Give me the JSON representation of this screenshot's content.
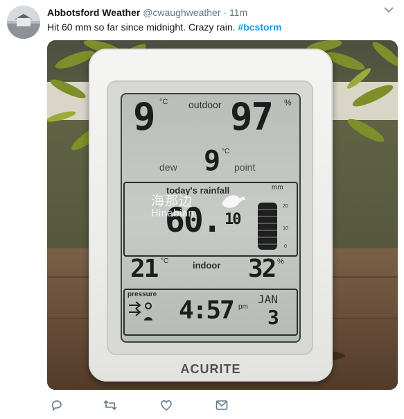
{
  "tweet": {
    "author_name": "Abbotsford Weather",
    "handle": "@cwaughweather",
    "separator": "·",
    "time": "11m",
    "text_plain": "Hit 60 mm so far since midnight. Crazy rain. ",
    "hashtag": "#bcstorm"
  },
  "station": {
    "outdoor_label": "outdoor",
    "outdoor_temp": "9",
    "outdoor_humidity": "97",
    "temp_unit": "°C",
    "humidity_unit": "%",
    "dew_label": "dew",
    "point_label": "point",
    "dew_point": "9",
    "rainfall_label": "today's rainfall",
    "rainfall_unit": "mm",
    "rainfall_value": "60.",
    "rainfall_decimal": "10",
    "gauge_ticks": [
      "20",
      "10",
      "0"
    ],
    "indoor_label": "indoor",
    "indoor_temp": "21",
    "indoor_humidity": "32",
    "pressure_label": "pressure",
    "time": "4:57",
    "ampm": "pm",
    "month": "JAN",
    "day": "3",
    "brand": "ACURITE"
  },
  "watermark": {
    "zh": "海那边",
    "en": "Hinabian"
  },
  "icons": [
    "reply-icon",
    "retweet-icon",
    "like-icon",
    "message-icon",
    "chevron-down-icon"
  ]
}
